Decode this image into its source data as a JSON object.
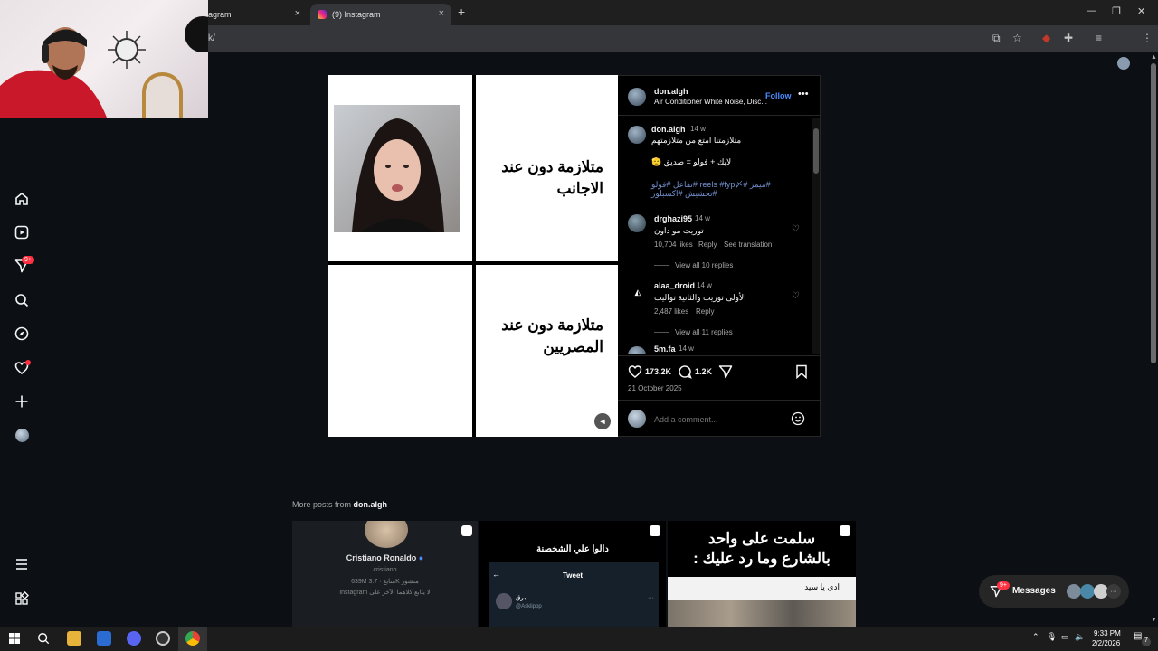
{
  "browser": {
    "tabs": [
      {
        "label": "agram"
      },
      {
        "label": "(9) Instagram"
      }
    ],
    "url": "k/",
    "close_glyph": "×",
    "new_tab_glyph": "+"
  },
  "nav": {
    "notifications_badge": "9+"
  },
  "post": {
    "meme_top": "متلازمة دون عند الاجانب",
    "meme_bottom": "متلازمة دون عند المصريين",
    "author": "don.algh",
    "audio": "Air Conditioner White Noise, Disc...",
    "follow": "Follow",
    "caption": {
      "user": "don.algh",
      "time": "14 w",
      "line1": "متلازمتنا امتع من متلازمتهم",
      "line2": "لايك + فولو = صديق 🫡",
      "tags1": "#ميمز #reels #fyp〆 #تفاعل #فولو",
      "tags2": "#تحشيش #اكسبلور"
    },
    "comments": [
      {
        "user": "drghazi95",
        "time": "14 w",
        "text": "توريت مو داون",
        "likes": "10,704 likes",
        "reply": "Reply",
        "translate": "See translation",
        "replies": "View all 10 replies"
      },
      {
        "user": "alaa_droid",
        "time": "14 w",
        "text": "الأولى توريت والثانية تواليت",
        "likes": "2,487 likes",
        "reply": "Reply",
        "replies": "View all 11 replies"
      },
      {
        "user": "5m.fa",
        "time": "14 w"
      }
    ],
    "like_count": "173.2K",
    "comment_count": "1.2K",
    "date": "21 October 2025",
    "add_comment_placeholder": "Add a comment..."
  },
  "more_posts": {
    "label": "More posts from",
    "user": "don.algh",
    "thumb1": {
      "name": "Cristiano Ronaldo",
      "handle": "cristiano",
      "stats": "639M  متابع · 3.7K  منشور",
      "line": "لا يتابع كلاهما الآخر على Instagram"
    },
    "thumb2": {
      "caption": "دالوا علي الشخصنة",
      "tweet": "Tweet",
      "name": "برق",
      "handle": "@Asklippp"
    },
    "thumb3": {
      "line1": "سلمت على واحد",
      "line2": "بالشارع وما رد عليك :",
      "reply": "ادي يا سيد"
    }
  },
  "messages": {
    "label": "Messages",
    "badge": "9+"
  },
  "taskbar": {
    "time": "9:33 PM",
    "date": "2/2/2026",
    "notif_count": "7"
  },
  "icons": {
    "home": "home-icon",
    "reels": "reels-icon",
    "messages": "send-icon",
    "search": "search-icon",
    "explore": "compass-icon",
    "notifications": "heart-icon",
    "create": "plus-icon",
    "menu": "menu-icon",
    "threads": "grid-icon"
  }
}
